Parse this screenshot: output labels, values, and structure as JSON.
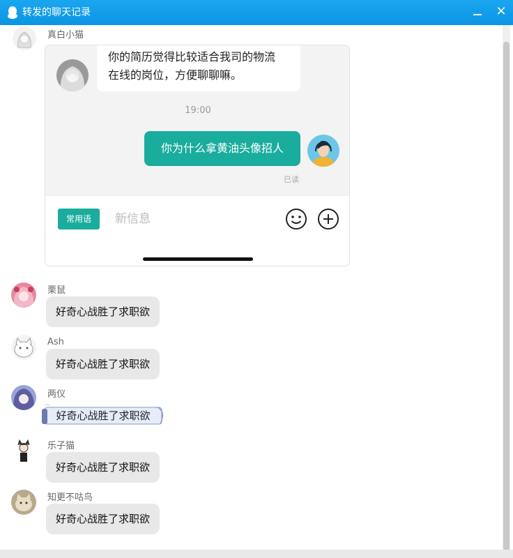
{
  "window": {
    "title": "转发的聊天记录"
  },
  "forwarded": {
    "sender": "真白小猫",
    "incoming_text_line1": "你的简历觉得比较适合我司的物流",
    "incoming_text_line2": "在线的岗位，方便聊聊嘛。",
    "time": "19:00",
    "outgoing_text": "你为什么拿黄油头像招人",
    "read_status": "已读",
    "quick_phrase_label": "常用语",
    "input_placeholder": "新信息"
  },
  "messages": [
    {
      "sender": "栗鼠",
      "text": "好奇心战胜了求职欲"
    },
    {
      "sender": "Ash",
      "text": "好奇心战胜了求职欲"
    },
    {
      "sender": "两仪",
      "text": "好奇心战胜了求职欲"
    },
    {
      "sender": "乐子猫",
      "text": "好奇心战胜了求职欲"
    },
    {
      "sender": "知更不咕鸟",
      "text": "好奇心战胜了求职欲"
    }
  ],
  "icons": {
    "app": "qq-penguin-icon",
    "minimize": "minimize-icon",
    "close": "close-icon",
    "emoji": "smiley-icon",
    "plus": "plus-circle-icon"
  },
  "colors": {
    "titlebar": "#0b95e4",
    "accent_green": "#1aac9d",
    "bubble_gray": "#e8e8e8"
  }
}
